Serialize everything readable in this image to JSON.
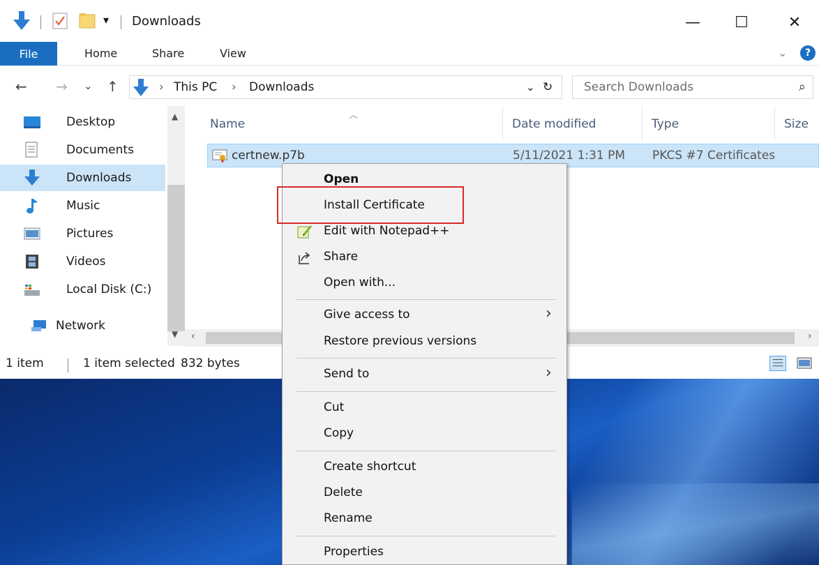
{
  "window": {
    "title": "Downloads",
    "minimize": "—",
    "maximize": "☐",
    "close": "✕"
  },
  "ribbon": {
    "file": "File",
    "home": "Home",
    "share": "Share",
    "view": "View",
    "collapse": "⌄",
    "help": "?"
  },
  "address": {
    "back": "←",
    "forward": "→",
    "recent": "⌄",
    "up": "↑",
    "crumbs": [
      "This PC",
      "Downloads"
    ],
    "crumb_sep": "›",
    "dropdown": "⌄",
    "refresh": "↻",
    "search_placeholder": "Search Downloads",
    "search_icon": "⌕"
  },
  "nav": {
    "items": [
      {
        "label": "Desktop",
        "icon": "desktop-icon"
      },
      {
        "label": "Documents",
        "icon": "documents-icon"
      },
      {
        "label": "Downloads",
        "icon": "downloads-icon",
        "selected": true
      },
      {
        "label": "Music",
        "icon": "music-icon"
      },
      {
        "label": "Pictures",
        "icon": "pictures-icon"
      },
      {
        "label": "Videos",
        "icon": "videos-icon"
      },
      {
        "label": "Local Disk (C:)",
        "icon": "local-disk-icon"
      },
      {
        "label": "Network",
        "icon": "network-icon"
      }
    ]
  },
  "list": {
    "columns": [
      "Name",
      "Date modified",
      "Type",
      "Size"
    ],
    "rows": [
      {
        "name": "certnew.p7b",
        "date": "5/11/2021 1:31 PM",
        "type": "PKCS #7 Certificates"
      }
    ]
  },
  "status": {
    "count": "1 item",
    "selected": "1 item selected",
    "size": "832 bytes"
  },
  "context_menu": {
    "items": [
      {
        "label": "Open",
        "bold": true
      },
      {
        "label": "Install Certificate"
      },
      {
        "label": "Edit with Notepad++",
        "icon": "notepadpp-icon"
      },
      {
        "label": "Share",
        "icon": "share-icon"
      },
      {
        "label": "Open with..."
      },
      {
        "label": "Give access to",
        "submenu": true
      },
      {
        "label": "Restore previous versions"
      },
      {
        "label": "Send to",
        "submenu": true
      },
      {
        "label": "Cut"
      },
      {
        "label": "Copy"
      },
      {
        "label": "Create shortcut"
      },
      {
        "label": "Delete"
      },
      {
        "label": "Rename"
      },
      {
        "label": "Properties"
      }
    ],
    "submenu_arrow": "›"
  },
  "colors": {
    "accent": "#1a6ec2",
    "selection": "#cce4f7",
    "highlight_box": "#d92828"
  }
}
